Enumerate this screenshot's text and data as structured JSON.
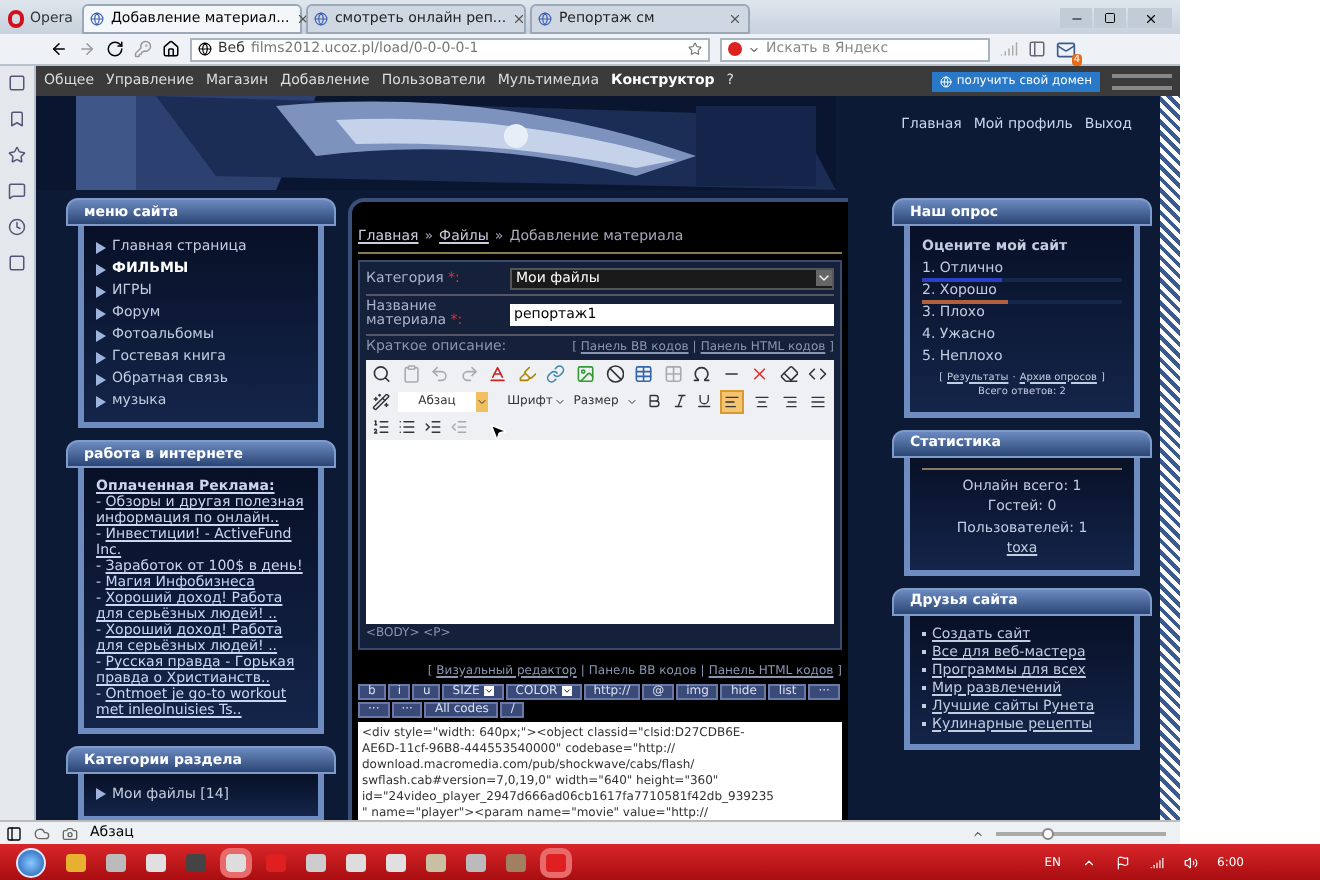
{
  "browser": {
    "opera_button": "Opera",
    "tabs": [
      {
        "title": "Добавление материал...",
        "selected": true
      },
      {
        "title": "смотреть онлайн реп...",
        "selected": false
      },
      {
        "title": "Репортаж см",
        "selected": false
      }
    ],
    "search_label": "Веб",
    "url": "films2012.ucoz.pl/load/0-0-0-0-1",
    "search_placeholder": "Искать в Яндекс",
    "notification_count": "4"
  },
  "admin_bar": {
    "items": [
      {
        "label": "Общее",
        "bold": false
      },
      {
        "label": "Управление",
        "bold": false
      },
      {
        "label": "Магазин",
        "bold": false
      },
      {
        "label": "Добавление",
        "bold": false
      },
      {
        "label": "Пользователи",
        "bold": false
      },
      {
        "label": "Мультимедиа",
        "bold": false
      },
      {
        "label": "Конструктор",
        "bold": true
      },
      {
        "label": "?",
        "bold": false
      }
    ],
    "domain_button": "получить свой домен"
  },
  "header": {
    "links": [
      "Главная",
      "Мой профиль",
      "Выход"
    ]
  },
  "site_menu": {
    "title": "меню сайта",
    "items": [
      {
        "label": "Главная страница",
        "selected": false
      },
      {
        "label": "ФИЛЬМЫ",
        "selected": true
      },
      {
        "label": "ИГРЫ",
        "selected": false
      },
      {
        "label": "Форум",
        "selected": false
      },
      {
        "label": "Фотоальбомы",
        "selected": false
      },
      {
        "label": "Гостевая книга",
        "selected": false
      },
      {
        "label": "Обратная связь",
        "selected": false
      },
      {
        "label": "музыка",
        "selected": false
      }
    ]
  },
  "ads": {
    "title": "работа в интернете",
    "heading": "Оплаченная Реклама:",
    "items": [
      {
        "dash": "-",
        "link": "Обзоры и другая полезная информация по онлайн.."
      },
      {
        "dash": "-",
        "link": "Инвестиции! - ActiveFund Inc."
      },
      {
        "dash": "-",
        "link": "Заработок от 100$ в день!"
      },
      {
        "dash": "-",
        "link": "Магия Инфобизнеса"
      },
      {
        "dash": "-",
        "link": "Хороший доход! Работа для серьёзных людей! .."
      },
      {
        "dash": "-",
        "link": "Хороший доход! Работа для серьёзных людей! .."
      },
      {
        "dash": "-",
        "link": "Русская правда - Горькая правда о Христианств.."
      },
      {
        "dash": "-",
        "link": "Ontmoet je go-to workout met inleolnuisies Ts.."
      }
    ]
  },
  "categories": {
    "title": "Категории раздела",
    "items": [
      "Мои файлы [14]"
    ]
  },
  "breadcrumb": {
    "separator": "»",
    "items": [
      {
        "label": "Главная",
        "link": true
      },
      {
        "label": "Файлы",
        "link": true
      },
      {
        "label": "Добавление материала",
        "link": false
      }
    ]
  },
  "form": {
    "category": {
      "label": "Категория",
      "required": "*:",
      "value": "Мои файлы"
    },
    "title": {
      "label": "Название материала",
      "required": "*:",
      "value": "репортаж1"
    },
    "description_label": "Краткое описание:",
    "panel_switch": {
      "open": "[",
      "sep": "|",
      "close": "]",
      "links": [
        "Панель BB кодов",
        "Панель HTML кодов"
      ]
    },
    "editor": {
      "format": "Абзац",
      "font": "Шрифт",
      "size": "Размер",
      "align_buttons": [
        {
          "selected": true
        },
        {
          "selected": false
        },
        {
          "selected": false
        },
        {
          "selected": false
        }
      ],
      "status": "<BODY>  <P>"
    },
    "code_switch": {
      "open": "[",
      "sep": "|",
      "close": "]",
      "items": [
        {
          "label": "Визуальный редактор",
          "link": true
        },
        {
          "label": "Панель BB кодов",
          "link": false
        },
        {
          "label": "Панель HTML кодов",
          "link": true
        }
      ]
    },
    "bb_buttons": [
      {
        "label": "b",
        "kind": "button"
      },
      {
        "label": "i",
        "kind": "button"
      },
      {
        "label": "u",
        "kind": "button"
      },
      {
        "label": "SIZE",
        "kind": "dropdown"
      },
      {
        "label": "COLOR",
        "kind": "dropdown"
      },
      {
        "label": "http://",
        "kind": "button"
      },
      {
        "label": "@",
        "kind": "button"
      },
      {
        "label": "img",
        "kind": "button"
      },
      {
        "label": "hide",
        "kind": "button"
      },
      {
        "label": "list",
        "kind": "button"
      },
      {
        "label": "···",
        "kind": "button"
      },
      {
        "label": "···",
        "kind": "button"
      },
      {
        "label": "···",
        "kind": "button"
      },
      {
        "label": "All codes",
        "kind": "button"
      },
      {
        "label": "/",
        "kind": "button"
      }
    ],
    "code_lines": [
      "<div style=\"width: 640px;\"><object classid=\"clsid:D27CDB6E-",
      "AE6D-11cf-96B8-444553540000\" codebase=\"http://",
      "download.macromedia.com/pub/shockwave/cabs/flash/",
      "swflash.cab#version=7,0,19,0\" width=\"640\" height=\"360\"",
      "id=\"24video_player_2947d666ad06cb1617fa7710581f42db_939235",
      "\" name=\"player\"><param name=\"movie\" value=\"http://"
    ]
  },
  "poll": {
    "title": "Наш опрос",
    "question": "Оцените мой сайт",
    "options": [
      {
        "label": "1. Отлично",
        "level": 0.4,
        "color": "#2b3fc4"
      },
      {
        "label": "2. Хорошо",
        "level": 0.43,
        "color": "#b0603c"
      },
      {
        "label": "3. Плохо"
      },
      {
        "label": "4. Ужасно"
      },
      {
        "label": "5. Неплохо"
      }
    ],
    "open": "[",
    "sep": "·",
    "close": "]",
    "links": [
      "Результаты",
      "Архив опросов"
    ],
    "total": "Всего ответов: 2"
  },
  "stats": {
    "title": "Статистика",
    "lines": [
      "Онлайн всего: 1",
      "Гостей: 0",
      "Пользователей: 1"
    ],
    "user": "toxa"
  },
  "friends": {
    "title": "Друзья сайта",
    "links": [
      "Создать сайт",
      "Все для веб-мастера",
      "Программы для всех",
      "Мир развлечений",
      "Лучшие сайты Рунета",
      "Кулинарные рецепты"
    ]
  },
  "status_bar": {
    "text": "Абзац",
    "zoom": {
      "level": 0.3
    }
  },
  "taskbar": {
    "language": "EN",
    "time": "6:00"
  }
}
